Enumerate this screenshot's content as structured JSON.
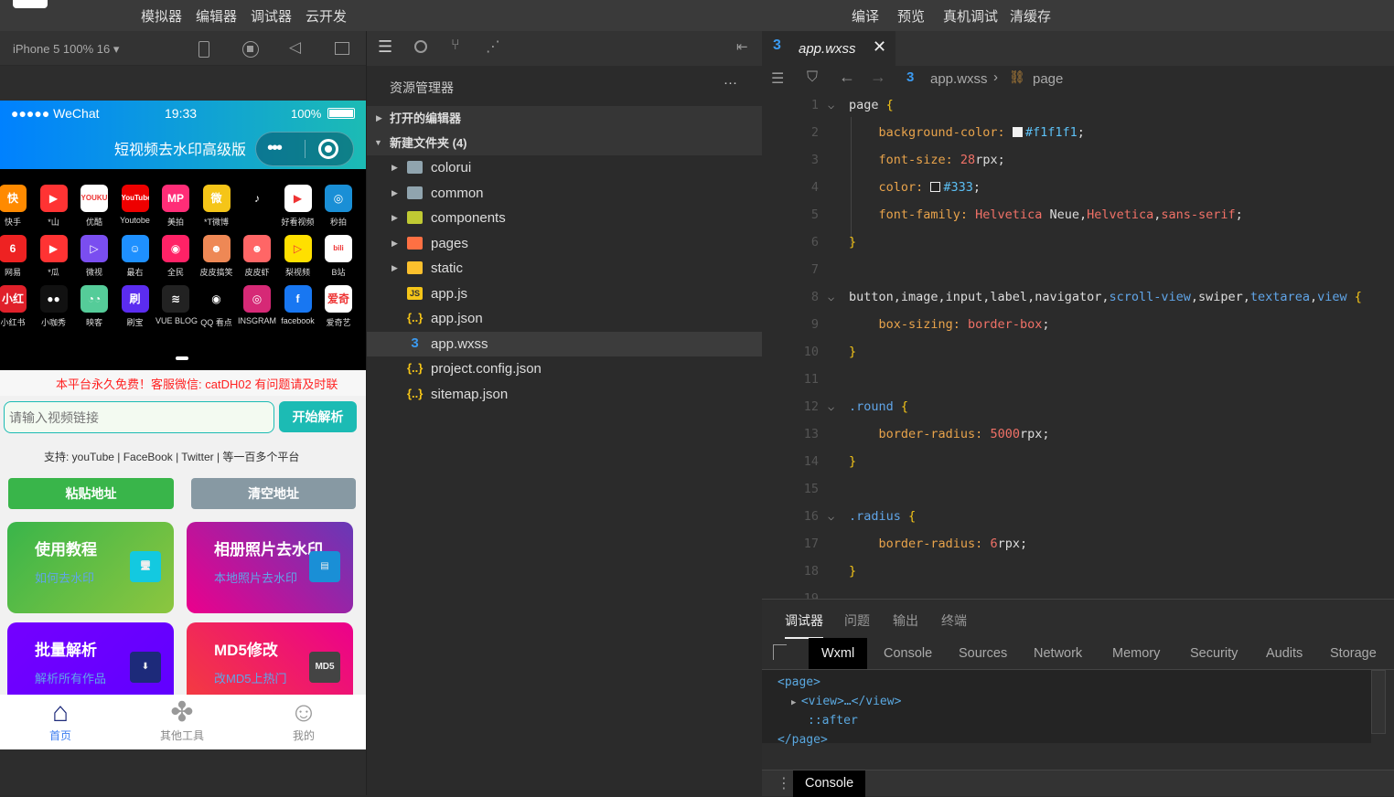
{
  "menu": {
    "left": [
      "模拟器",
      "编辑器",
      "调试器",
      "云开发"
    ],
    "right": [
      "编译",
      "预览",
      "真机调试",
      "清缓存"
    ]
  },
  "simulator": {
    "device": "iPhone 5 100% 16 ▾"
  },
  "phone": {
    "carrier": "●●●●● WeChat",
    "time": "19:33",
    "battery": "100%",
    "title": "短视频去水印高级版",
    "apps": [
      {
        "label": "快手",
        "glyph": "快",
        "color": "#ff8a00"
      },
      {
        "label": "*山",
        "glyph": "▶",
        "color": "#f33"
      },
      {
        "label": "优酷",
        "glyph": "YOUKU",
        "color": "#fff"
      },
      {
        "label": "Youtobe",
        "glyph": "YouTube",
        "color": "#e00"
      },
      {
        "label": "美拍",
        "glyph": "MP",
        "color": "#ff2d77"
      },
      {
        "label": "*T微博",
        "glyph": "微",
        "color": "#f5c518"
      },
      {
        "label": "",
        "glyph": "♪",
        "color": "#000"
      },
      {
        "label": "好看视频",
        "glyph": "▶",
        "color": "#fff"
      },
      {
        "label": "秒拍",
        "glyph": "◎",
        "color": "#1a8fd6"
      },
      {
        "label": "网易",
        "glyph": "6",
        "color": "#e22"
      },
      {
        "label": "*瓜",
        "glyph": "▶",
        "color": "#f33"
      },
      {
        "label": "微视",
        "glyph": "▷",
        "color": "#7a4ef0"
      },
      {
        "label": "最右",
        "glyph": "☺",
        "color": "#1e90ff"
      },
      {
        "label": "全民",
        "glyph": "◉",
        "color": "#ff2266"
      },
      {
        "label": "皮皮搞笑",
        "glyph": "☻",
        "color": "#e85"
      },
      {
        "label": "皮皮虾",
        "glyph": "☻",
        "color": "#f66"
      },
      {
        "label": "梨视频",
        "glyph": "▷",
        "color": "#ffe000"
      },
      {
        "label": "B站",
        "glyph": "bili",
        "color": "#fff"
      },
      {
        "label": "小红书",
        "glyph": "小红书",
        "color": "#e0202a"
      },
      {
        "label": "小咖秀",
        "glyph": "●●",
        "color": "#111"
      },
      {
        "label": "映客",
        "glyph": "◔◔",
        "color": "#5c9"
      },
      {
        "label": "刷宝",
        "glyph": "刷",
        "color": "#5b2cf0"
      },
      {
        "label": "VUE BLOG",
        "glyph": "≋",
        "color": "#222"
      },
      {
        "label": "QQ 看点",
        "glyph": "◉",
        "color": "#000"
      },
      {
        "label": "INSGRAM",
        "glyph": "◎",
        "color": "#d62976"
      },
      {
        "label": "facebook",
        "glyph": "f",
        "color": "#1877f2"
      },
      {
        "label": "爱奇艺",
        "glyph": "爱奇艺",
        "color": "#fff"
      }
    ],
    "notice": "本平台永久免费！客服微信: catDH02 有问题请及时联",
    "input_placeholder": "请输入视频链接",
    "parse_button": "开始解析",
    "support": "支持:   youTube | FaceBook | Twitter | 等一百多个平台",
    "paste_button": "粘贴地址",
    "clear_button": "清空地址",
    "cards": [
      {
        "title": "使用教程",
        "sub": "如何去水印",
        "glyph": "🖥"
      },
      {
        "title": "相册照片去水印",
        "sub": "本地照片去水印",
        "glyph": "▤"
      },
      {
        "title": "批量解析",
        "sub": "解析所有作品",
        "glyph": "⬇"
      },
      {
        "title": "MD5修改",
        "sub": "改MD5上热门",
        "glyph": "MD5"
      }
    ],
    "tabs": [
      {
        "label": "首页",
        "active": true
      },
      {
        "label": "其他工具"
      },
      {
        "label": "我的"
      }
    ],
    "accent": "#0081ff"
  },
  "explorer": {
    "title": "资源管理器",
    "more": "···",
    "open_editors": "打开的编辑器",
    "folder": "新建文件夹 (4)",
    "items": [
      {
        "name": "colorui",
        "type": "folder"
      },
      {
        "name": "common",
        "type": "folder"
      },
      {
        "name": "components",
        "type": "folder"
      },
      {
        "name": "pages",
        "type": "folder"
      },
      {
        "name": "static",
        "type": "folder"
      },
      {
        "name": "app.js",
        "type": "js"
      },
      {
        "name": "app.json",
        "type": "json"
      },
      {
        "name": "app.wxss",
        "type": "wxss",
        "selected": true
      },
      {
        "name": "project.config.json",
        "type": "json"
      },
      {
        "name": "sitemap.json",
        "type": "json"
      }
    ]
  },
  "editor": {
    "tab": "app.wxss",
    "breadcrumb": [
      "app.wxss",
      "page"
    ],
    "lines": [
      [
        [
          "page ",
          "p"
        ],
        [
          "{",
          "b"
        ]
      ],
      [
        [
          "    background-color: ",
          "k"
        ],
        [
          "SW#f1f1f1",
          ""
        ],
        [
          "#f1f1f1",
          "h"
        ],
        [
          ";",
          "p"
        ]
      ],
      [
        [
          "    font-size: ",
          "k"
        ],
        [
          "28",
          "v"
        ],
        [
          "rpx;",
          "p"
        ]
      ],
      [
        [
          "    color: ",
          "k"
        ],
        [
          "SW#333",
          ""
        ],
        [
          "#333",
          "h"
        ],
        [
          ";",
          "p"
        ]
      ],
      [
        [
          "    font-family: ",
          "k"
        ],
        [
          "Helvetica ",
          "v"
        ],
        [
          "Neue,",
          "p"
        ],
        [
          "Helvetica",
          "v"
        ],
        [
          ",",
          "p"
        ],
        [
          "sans-serif",
          "v"
        ],
        [
          ";",
          "p"
        ]
      ],
      [
        [
          "}",
          "b"
        ]
      ],
      [],
      [
        [
          "button,image,input,label,navigator,",
          "p"
        ],
        [
          "scroll-view",
          "s"
        ],
        [
          ",swiper,",
          "p"
        ],
        [
          "textarea",
          "s"
        ],
        [
          ",",
          "p"
        ],
        [
          "view",
          "s"
        ],
        [
          " {",
          "b"
        ]
      ],
      [
        [
          "    box-sizing: ",
          "k"
        ],
        [
          "border-box",
          "v"
        ],
        [
          ";",
          "p"
        ]
      ],
      [
        [
          "}",
          "b"
        ]
      ],
      [],
      [
        [
          ".round ",
          "s"
        ],
        [
          "{",
          "b"
        ]
      ],
      [
        [
          "    border-radius: ",
          "k"
        ],
        [
          "5000",
          "v"
        ],
        [
          "rpx;",
          "p"
        ]
      ],
      [
        [
          "}",
          "b"
        ]
      ],
      [],
      [
        [
          ".radius ",
          "s"
        ],
        [
          "{",
          "b"
        ]
      ],
      [
        [
          "    border-radius: ",
          "k"
        ],
        [
          "6",
          "v"
        ],
        [
          "rpx;",
          "p"
        ]
      ],
      [
        [
          "}",
          "b"
        ]
      ],
      []
    ]
  },
  "devtools": {
    "tabs": [
      "调试器",
      "问题",
      "输出",
      "终端"
    ],
    "subtabs": [
      "Wxml",
      "Console",
      "Sources",
      "Network",
      "Memory",
      "Security",
      "Audits",
      "Storage"
    ],
    "tree": [
      "<page>",
      "<view>…</view>",
      "::after",
      "</page>"
    ],
    "drawer": "Console"
  }
}
